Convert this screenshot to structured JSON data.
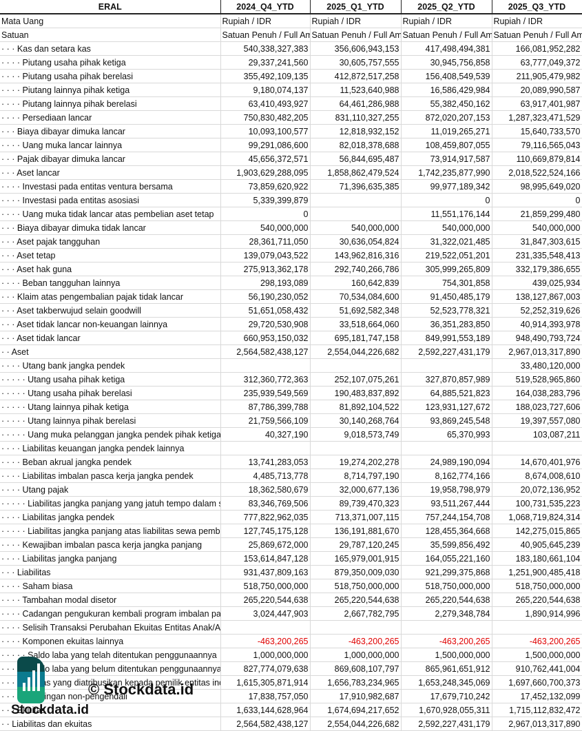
{
  "header": {
    "company": "ERAL",
    "periods": [
      "2024_Q4_YTD",
      "2025_Q1_YTD",
      "2025_Q2_YTD",
      "2025_Q3_YTD"
    ]
  },
  "meta_rows": [
    {
      "label": "Mata Uang",
      "values": [
        "Rupiah / IDR",
        "Rupiah / IDR",
        "Rupiah / IDR",
        "Rupiah / IDR"
      ]
    },
    {
      "label": "Satuan",
      "values": [
        "Satuan Penuh / Full Amount",
        "Satuan Penuh / Full Amount",
        "Satuan Penuh / Full Amount",
        "Satuan Penuh / Full Amount"
      ]
    }
  ],
  "rows": [
    {
      "label": "· · · Kas dan setara kas",
      "values": [
        "540,338,327,383",
        "356,606,943,153",
        "417,498,494,381",
        "166,081,952,282"
      ]
    },
    {
      "label": "· · · · Piutang usaha pihak ketiga",
      "values": [
        "29,337,241,560",
        "30,605,757,555",
        "30,945,756,858",
        "63,777,049,372"
      ]
    },
    {
      "label": "· · · · Piutang usaha pihak berelasi",
      "values": [
        "355,492,109,135",
        "412,872,517,258",
        "156,408,549,539",
        "211,905,479,982"
      ]
    },
    {
      "label": "· · · · Piutang lainnya pihak ketiga",
      "values": [
        "9,180,074,137",
        "11,523,640,988",
        "16,586,429,984",
        "20,089,990,587"
      ]
    },
    {
      "label": "· · · · Piutang lainnya pihak berelasi",
      "values": [
        "63,410,493,927",
        "64,461,286,988",
        "55,382,450,162",
        "63,917,401,987"
      ]
    },
    {
      "label": "· · · · Persediaan lancar",
      "values": [
        "750,830,482,205",
        "831,110,327,255",
        "872,020,207,153",
        "1,287,323,471,529"
      ]
    },
    {
      "label": "· · · Biaya dibayar dimuka lancar",
      "values": [
        "10,093,100,577",
        "12,818,932,152",
        "11,019,265,271",
        "15,640,733,570"
      ]
    },
    {
      "label": "· · · · Uang muka lancar lainnya",
      "values": [
        "99,291,086,600",
        "82,018,378,688",
        "108,459,807,055",
        "79,116,565,043"
      ]
    },
    {
      "label": "· · · Pajak dibayar dimuka lancar",
      "values": [
        "45,656,372,571",
        "56,844,695,487",
        "73,914,917,587",
        "110,669,879,814"
      ]
    },
    {
      "label": "· · · Aset lancar",
      "values": [
        "1,903,629,288,095",
        "1,858,862,479,524",
        "1,742,235,877,990",
        "2,018,522,524,166"
      ]
    },
    {
      "label": "· · · · Investasi pada entitas ventura bersama",
      "values": [
        "73,859,620,922",
        "71,396,635,385",
        "99,977,189,342",
        "98,995,649,020"
      ]
    },
    {
      "label": "· · · · Investasi pada entitas asosiasi",
      "values": [
        "5,339,399,879",
        "",
        "0",
        "0"
      ]
    },
    {
      "label": "· · · · Uang muka tidak lancar atas pembelian aset tetap",
      "values": [
        "0",
        "",
        "11,551,176,144",
        "21,859,299,480"
      ]
    },
    {
      "label": "· · · Biaya dibayar dimuka tidak lancar",
      "values": [
        "540,000,000",
        "540,000,000",
        "540,000,000",
        "540,000,000"
      ]
    },
    {
      "label": "· · · Aset pajak tangguhan",
      "values": [
        "28,361,711,050",
        "30,636,054,824",
        "31,322,021,485",
        "31,847,303,615"
      ]
    },
    {
      "label": "· · · Aset tetap",
      "values": [
        "139,079,043,522",
        "143,962,816,316",
        "219,522,051,201",
        "231,335,548,413"
      ]
    },
    {
      "label": "· · · Aset hak guna",
      "values": [
        "275,913,362,178",
        "292,740,266,786",
        "305,999,265,809",
        "332,179,386,655"
      ]
    },
    {
      "label": "· · · · Beban tangguhan lainnya",
      "values": [
        "298,193,089",
        "160,642,839",
        "754,301,858",
        "439,025,934"
      ]
    },
    {
      "label": "· · · Klaim atas pengembalian pajak tidak lancar",
      "values": [
        "56,190,230,052",
        "70,534,084,600",
        "91,450,485,179",
        "138,127,867,003"
      ]
    },
    {
      "label": "· · · Aset takberwujud selain goodwill",
      "values": [
        "51,651,058,432",
        "51,692,582,348",
        "52,523,778,321",
        "52,252,319,626"
      ]
    },
    {
      "label": "· · · Aset tidak lancar non-keuangan lainnya",
      "values": [
        "29,720,530,908",
        "33,518,664,060",
        "36,351,283,850",
        "40,914,393,978"
      ]
    },
    {
      "label": "· · · Aset tidak lancar",
      "values": [
        "660,953,150,032",
        "695,181,747,158",
        "849,991,553,189",
        "948,490,793,724"
      ]
    },
    {
      "label": "· · Aset",
      "values": [
        "2,564,582,438,127",
        "2,554,044,226,682",
        "2,592,227,431,179",
        "2,967,013,317,890"
      ]
    },
    {
      "label": "· · · · Utang bank jangka pendek",
      "values": [
        "",
        "",
        "",
        "33,480,120,000"
      ]
    },
    {
      "label": "· · · · · Utang usaha pihak ketiga",
      "values": [
        "312,360,772,363",
        "252,107,075,261",
        "327,870,857,989",
        "519,528,965,860"
      ]
    },
    {
      "label": "· · · · · Utang usaha pihak berelasi",
      "values": [
        "235,939,549,569",
        "190,483,837,892",
        "64,885,521,823",
        "164,038,283,796"
      ]
    },
    {
      "label": "· · · · · Utang lainnya pihak ketiga",
      "values": [
        "87,786,399,788",
        "81,892,104,522",
        "123,931,127,672",
        "188,023,727,606"
      ]
    },
    {
      "label": "· · · · · Utang lainnya pihak berelasi",
      "values": [
        "21,759,566,109",
        "30,140,268,764",
        "93,869,245,548",
        "19,397,557,080"
      ]
    },
    {
      "label": "· · · · · Uang muka pelanggan jangka pendek pihak ketiga",
      "values": [
        "40,327,190",
        "9,018,573,749",
        "65,370,993",
        "103,087,211"
      ]
    },
    {
      "label": "· · · · Liabilitas keuangan jangka pendek lainnya",
      "values": [
        "",
        "",
        "",
        ""
      ]
    },
    {
      "label": "· · · · Beban akrual jangka pendek",
      "values": [
        "13,741,283,053",
        "19,274,202,278",
        "24,989,190,094",
        "14,670,401,976"
      ]
    },
    {
      "label": "· · · · Liabilitas imbalan pasca kerja jangka pendek",
      "values": [
        "4,485,713,778",
        "8,714,797,190",
        "8,162,774,166",
        "8,674,008,610"
      ]
    },
    {
      "label": "· · · · Utang pajak",
      "values": [
        "18,362,580,679",
        "32,000,677,136",
        "19,958,798,979",
        "20,072,136,952"
      ]
    },
    {
      "label": "· · · · · Liabilitas jangka panjang yang jatuh tempo dalam satu tahun",
      "values": [
        "83,346,769,506",
        "89,739,470,323",
        "93,511,267,444",
        "100,731,535,223"
      ]
    },
    {
      "label": "· · · · Liabilitas jangka pendek",
      "values": [
        "777,822,962,035",
        "713,371,007,115",
        "757,244,154,708",
        "1,068,719,824,314"
      ]
    },
    {
      "label": "· · · · · Liabilitas jangka panjang atas liabilitas sewa pembiayaan",
      "values": [
        "127,745,175,128",
        "136,191,881,670",
        "128,455,364,668",
        "142,275,015,865"
      ]
    },
    {
      "label": "· · · · Kewajiban imbalan pasca kerja jangka panjang",
      "values": [
        "25,869,672,000",
        "29,787,120,245",
        "35,599,856,492",
        "40,905,645,239"
      ]
    },
    {
      "label": "· · · · Liabilitas jangka panjang",
      "values": [
        "153,614,847,128",
        "165,979,001,915",
        "164,055,221,160",
        "183,180,661,104"
      ]
    },
    {
      "label": "· · · Liabilitas",
      "values": [
        "931,437,809,163",
        "879,350,009,030",
        "921,299,375,868",
        "1,251,900,485,418"
      ]
    },
    {
      "label": "· · · · Saham biasa",
      "values": [
        "518,750,000,000",
        "518,750,000,000",
        "518,750,000,000",
        "518,750,000,000"
      ]
    },
    {
      "label": "· · · · Tambahan modal disetor",
      "values": [
        "265,220,544,638",
        "265,220,544,638",
        "265,220,544,638",
        "265,220,544,638"
      ]
    },
    {
      "label": "· · · · Cadangan pengukuran kembali program imbalan pasti",
      "values": [
        "3,024,447,903",
        "2,667,782,795",
        "2,279,348,784",
        "1,890,914,996"
      ]
    },
    {
      "label": "· · · · Selisih Transaksi Perubahan Ekuitas Entitas Anak/Asosiasi",
      "values": [
        "",
        "",
        "",
        ""
      ]
    },
    {
      "label": "· · · · Komponen ekuitas lainnya",
      "values": [
        "-463,200,265",
        "-463,200,265",
        "-463,200,265",
        "-463,200,265"
      ]
    },
    {
      "label": "· · · · · Saldo laba yang telah ditentukan penggunaannya",
      "values": [
        "1,000,000,000",
        "1,000,000,000",
        "1,500,000,000",
        "1,500,000,000"
      ]
    },
    {
      "label": "· · · · · Saldo laba yang belum ditentukan penggunaannya",
      "values": [
        "827,774,079,638",
        "869,608,107,797",
        "865,961,651,912",
        "910,762,441,004"
      ]
    },
    {
      "label": "· · · · Ekuitas yang diatribusikan kepada pemilik entitas induk",
      "values": [
        "1,615,305,871,914",
        "1,656,783,234,965",
        "1,653,248,345,069",
        "1,697,660,700,373"
      ]
    },
    {
      "label": "· · · Kepentingan non-pengendali",
      "values": [
        "17,838,757,050",
        "17,910,982,687",
        "17,679,710,242",
        "17,452,132,099"
      ]
    },
    {
      "label": "· · · Ekuitas",
      "values": [
        "1,633,144,628,964",
        "1,674,694,217,652",
        "1,670,928,055,311",
        "1,715,112,832,472"
      ]
    },
    {
      "label": "· · Liabilitas dan ekuitas",
      "values": [
        "2,564,582,438,127",
        "2,554,044,226,682",
        "2,592,227,431,179",
        "2,967,013,317,890"
      ]
    }
  ],
  "watermark": {
    "text": "© Stockdata.id",
    "logo_text": "Stockdata.id"
  },
  "colors": {
    "negative": "#e00000",
    "grid": "#d9d9d9",
    "logo_dark": "#0b4a4a",
    "logo_mid": "#0b7b8f",
    "logo_green": "#1aa57a"
  }
}
